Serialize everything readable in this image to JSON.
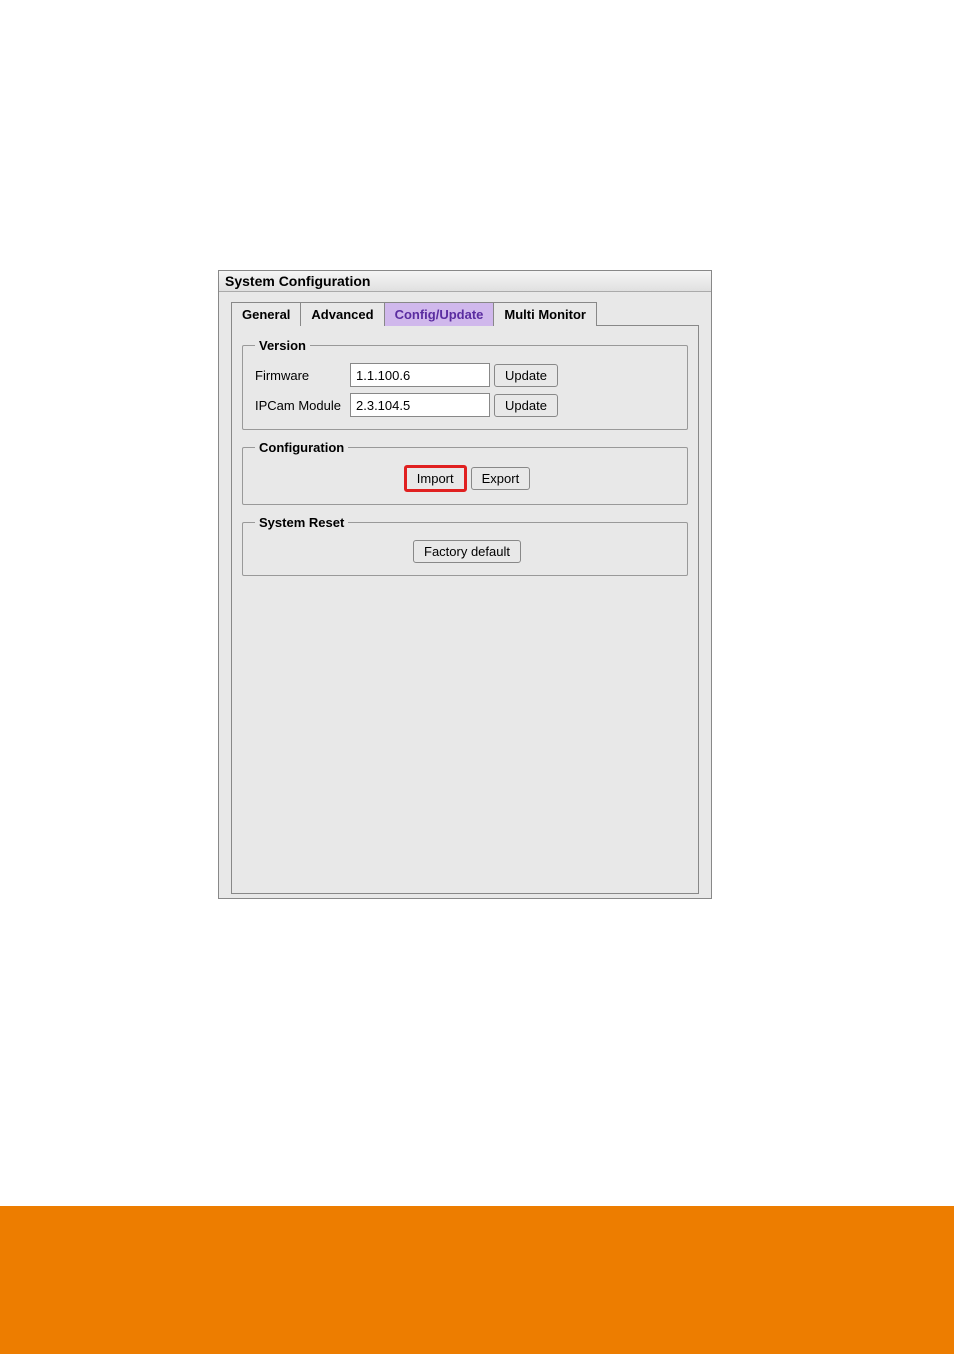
{
  "window": {
    "title": "System Configuration"
  },
  "tabs": {
    "general": "General",
    "advanced": "Advanced",
    "config_update": "Config/Update",
    "multi_monitor": "Multi Monitor"
  },
  "version": {
    "legend": "Version",
    "firmware_label": "Firmware",
    "firmware_value": "1.1.100.6",
    "firmware_update_btn": "Update",
    "ipcam_label": "IPCam Module",
    "ipcam_value": "2.3.104.5",
    "ipcam_update_btn": "Update"
  },
  "configuration": {
    "legend": "Configuration",
    "import_btn": "Import",
    "export_btn": "Export"
  },
  "system_reset": {
    "legend": "System Reset",
    "factory_default_btn": "Factory default"
  }
}
